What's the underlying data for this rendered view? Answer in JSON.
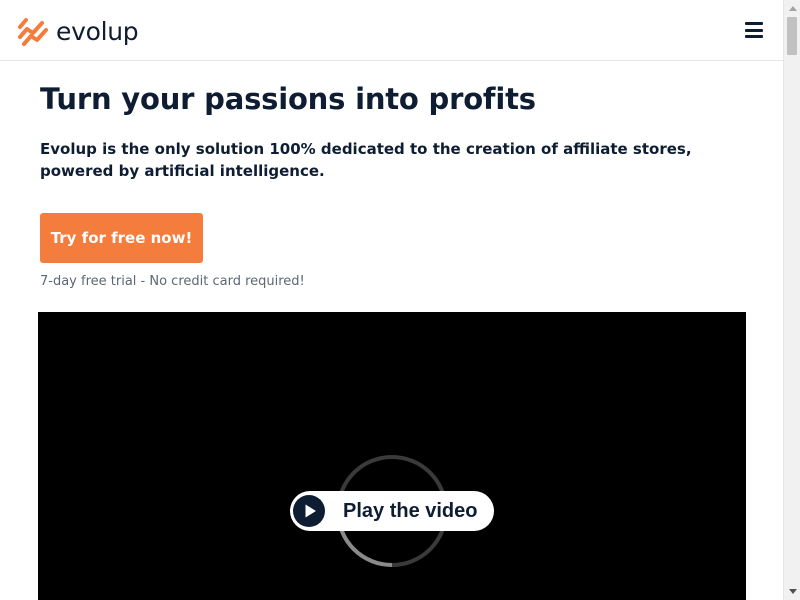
{
  "header": {
    "brand": "evolup",
    "logo_icon": "evolup-chart-logo",
    "menu_icon": "hamburger-menu-icon",
    "brand_color": "#f47c3c"
  },
  "hero": {
    "title": "Turn your passions into profits",
    "subtitle": "Evolup is the only solution 100% dedicated to the creation of affiliate stores, powered by artificial intelligence.",
    "cta_label": "Try for free now!",
    "trial_note": "7-day free trial - No credit card required!"
  },
  "video": {
    "play_label": "Play the video",
    "play_icon": "play-icon",
    "background": "#000000"
  },
  "colors": {
    "accent": "#f47c3c",
    "text": "#0f1d33",
    "muted": "#5f6772"
  }
}
